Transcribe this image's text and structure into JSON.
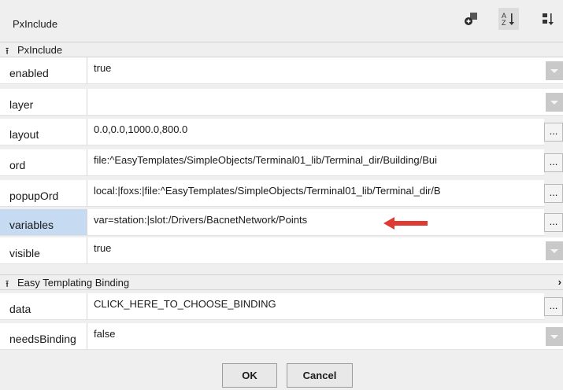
{
  "window": {
    "title": "PxInclude"
  },
  "toolbar": {
    "icons": [
      "add-slot-icon",
      "sort-alphabetical-icon",
      "sort-order-icon"
    ]
  },
  "sections": [
    {
      "title": "PxInclude",
      "rows": [
        {
          "name": "enabled",
          "value": "true",
          "editor": "dropdown"
        },
        {
          "name": "layer",
          "value": "",
          "editor": "dropdown"
        },
        {
          "name": "layout",
          "value": "0.0,0.0,1000.0,800.0",
          "editor": "ellipsis"
        },
        {
          "name": "ord",
          "value": "file:^EasyTemplates/SimpleObjects/Terminal01_lib/Terminal_dir/Building/Bui",
          "editor": "ellipsis"
        },
        {
          "name": "popupOrd",
          "value": "local:|foxs:|file:^EasyTemplates/SimpleObjects/Terminal01_lib/Terminal_dir/B",
          "editor": "ellipsis"
        },
        {
          "name": "variables",
          "value": "var=station:|slot:/Drivers/BacnetNetwork/Points",
          "editor": "ellipsis",
          "selected": true
        },
        {
          "name": "visible",
          "value": "true",
          "editor": "dropdown"
        }
      ]
    },
    {
      "title": "Easy Templating Binding",
      "rows": [
        {
          "name": "data",
          "value": "CLICK_HERE_TO_CHOOSE_BINDING",
          "editor": "ellipsis"
        },
        {
          "name": "needsBinding",
          "value": "false",
          "editor": "dropdown"
        }
      ]
    }
  ],
  "ellipsis_label": "...",
  "buttons": {
    "ok": "OK",
    "cancel": "Cancel"
  },
  "colors": {
    "selected_row": "#c6dbf2",
    "annotation_arrow": "#e03a33"
  }
}
